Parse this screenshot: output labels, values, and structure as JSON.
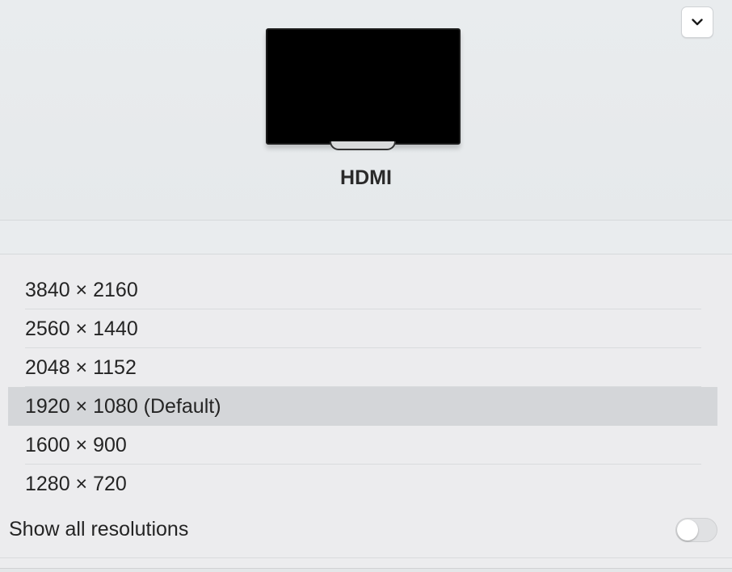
{
  "header": {
    "display_name": "HDMI",
    "dropdown_icon": "chevron-down-icon"
  },
  "resolutions": [
    {
      "label": "3840 × 2160",
      "selected": false
    },
    {
      "label": "2560 × 1440",
      "selected": false
    },
    {
      "label": "2048 × 1152",
      "selected": false
    },
    {
      "label": "1920 × 1080 (Default)",
      "selected": true
    },
    {
      "label": "1600 × 900",
      "selected": false
    },
    {
      "label": "1280 × 720",
      "selected": false
    }
  ],
  "show_all": {
    "label": "Show all resolutions",
    "enabled": false
  },
  "colors": {
    "selected_row": "#d4d6d9",
    "background": "#ececee"
  }
}
